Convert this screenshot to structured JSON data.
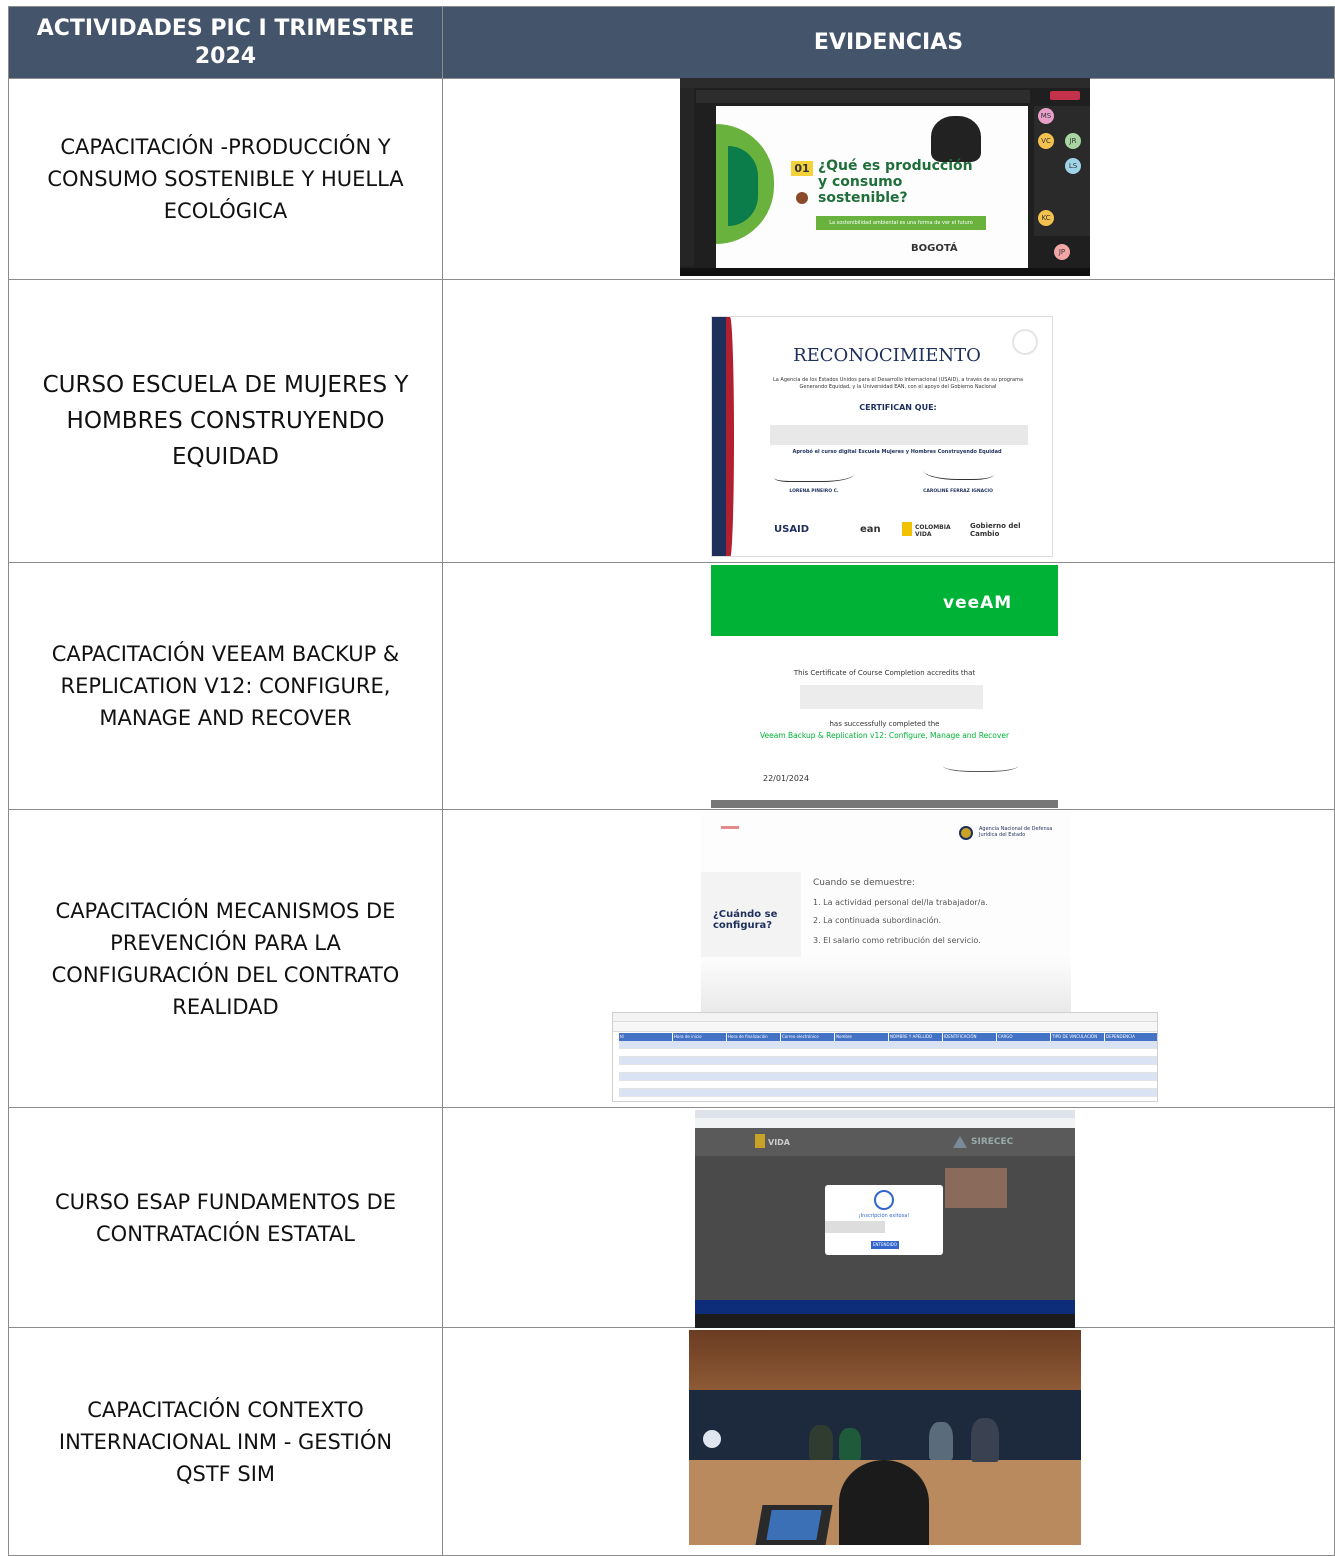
{
  "table": {
    "headers": {
      "activities": "ACTIVIDADES PIC I TRIMESTRE 2024",
      "evidence": "EVIDENCIAS"
    },
    "rows": [
      {
        "activity": "CAPACITACIÓN -PRODUCCIÓN Y CONSUMO SOSTENIBLE Y HUELLA ECOLÓGICA"
      },
      {
        "activity": "CURSO ESCUELA DE MUJERES Y HOMBRES CONSTRUYENDO EQUIDAD"
      },
      {
        "activity": "CAPACITACIÓN VEEAM BACKUP & REPLICATION V12: CONFIGURE, MANAGE AND RECOVER"
      },
      {
        "activity": "CAPACITACIÓN MECANISMOS DE PREVENCIÓN PARA LA CONFIGURACIÓN DEL CONTRATO REALIDAD"
      },
      {
        "activity": "CURSO ESAP FUNDAMENTOS DE CONTRATACIÓN ESTATAL"
      },
      {
        "activity": "CAPACITACIÓN CONTEXTO INTERNACIONAL INM - GESTIÓN QSTF SIM"
      }
    ]
  },
  "evidence1": {
    "slide_number": "01",
    "slide_title": "¿Qué es producción y consumo sostenible?",
    "slide_banner": "La sostenibilidad ambiental es una forma de ver el futuro",
    "logo": "BOGOTÁ",
    "participants": [
      "MS",
      "JR",
      "VC",
      "LS",
      "KC",
      "JP"
    ]
  },
  "evidence2": {
    "title": "RECONOCIMIENTO",
    "intro": "La Agencia de los Estados Unidos para el Desarrollo Internacional (USAID), a través de su programa Generando Equidad, y la Universidad EAN, con el apoyo del Gobierno Nacional",
    "certify": "CERTIFICAN QUE:",
    "course": "Aprobó el curso digital Escuela Mujeres y Hombres Construyendo Equidad",
    "signer1": "LORENA PIÑEIRO C.",
    "signer2": "CAROLINE FERRAZ IGNACIO",
    "logos": [
      "USAID",
      "ean",
      "COLOMBIA VIDA",
      "Gobierno del Cambio"
    ]
  },
  "evidence3": {
    "brand": "veeAM",
    "line1": "This Certificate of Course Completion accredits that",
    "line2": "has successfully completed the",
    "course": "Veeam Backup & Replication v12: Configure, Manage and Recover",
    "date": "22/01/2024"
  },
  "evidence4": {
    "agency": "Agencia Nacional de Defensa Jurídica del Estado",
    "question": "¿Cuándo se configura?",
    "intro": "Cuando se demuestre:",
    "items": [
      "1. La actividad personal del/la trabajador/a.",
      "2. La continuada subordinación.",
      "3. El salario como retribución del servicio."
    ],
    "sheet_headers": [
      "Id",
      "Hora de inicio",
      "Hora de finalización",
      "Correo electrónico",
      "Nombre",
      "NOMBRE Y APELLIDO",
      "IDENTIFICACIÓN",
      "CARGO",
      "TIPO DE VINCULACIÓN",
      "DEPENDENCIA"
    ]
  },
  "evidence5": {
    "left_logo": "VIDA",
    "right_logo": "SIRECEC",
    "modal_title": "¡Inscripción exitosa!",
    "modal_button": "ENTENDIDO"
  },
  "colors": {
    "header_bg": "#44546a",
    "border": "#8c8c8c",
    "green": "#6ab23e",
    "veeam_green": "#00b336"
  }
}
